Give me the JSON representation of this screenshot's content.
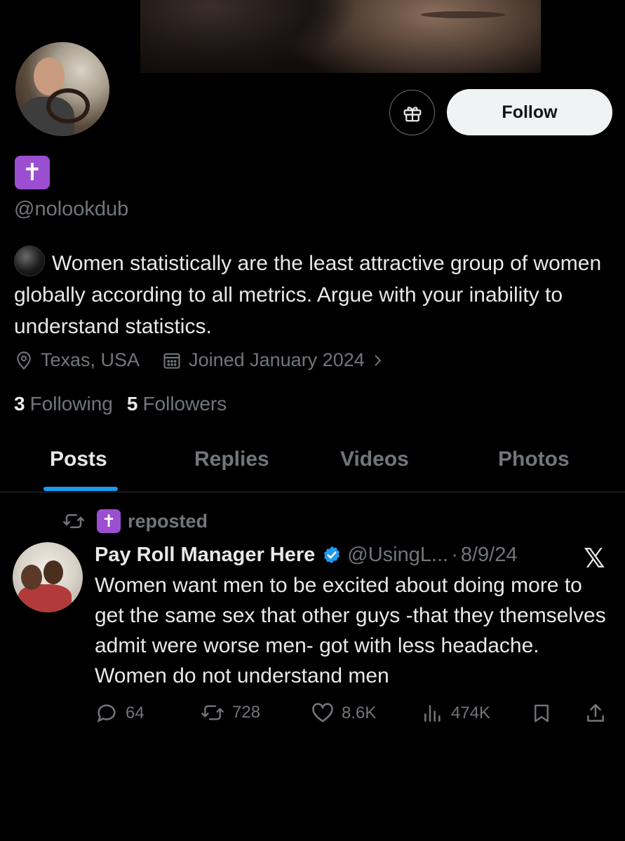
{
  "profile": {
    "name_emoji": "✝",
    "handle": "@nolookdub",
    "bio_emoji": "black-circle-icon",
    "bio": "Women statistically are the least attractive group of women globally according to all metrics. Argue with your inability to understand statistics.",
    "location": "Texas, USA",
    "joined": "Joined January 2024",
    "following_count": "3",
    "following_label": "Following",
    "followers_count": "5",
    "followers_label": "Followers",
    "follow_label": "Follow"
  },
  "tabs": [
    {
      "label": "Posts",
      "active": true
    },
    {
      "label": "Replies",
      "active": false
    },
    {
      "label": "Videos",
      "active": false
    },
    {
      "label": "Photos",
      "active": false
    }
  ],
  "post": {
    "repost_emoji": "✝",
    "repost_label": "reposted",
    "author_name": "Pay Roll Manager Here",
    "author_handle": "@UsingL...",
    "date": "8/9/24",
    "separator": "·",
    "text": "Women want men to be excited about doing more to get the same sex that other guys -that they themselves admit were worse men- got with less headache. Women do not understand men",
    "x_logo": "𝕏",
    "stats": {
      "replies": "64",
      "reposts": "728",
      "likes": "8.6K",
      "views": "474K"
    }
  },
  "colors": {
    "background": "#000000",
    "text": "#e7e9ea",
    "muted": "#71767b",
    "accent": "#1d9bf0",
    "verified": "#1d9bf0",
    "emoji_purple": "#9b4fd0",
    "follow_bg": "#eff3f4"
  }
}
